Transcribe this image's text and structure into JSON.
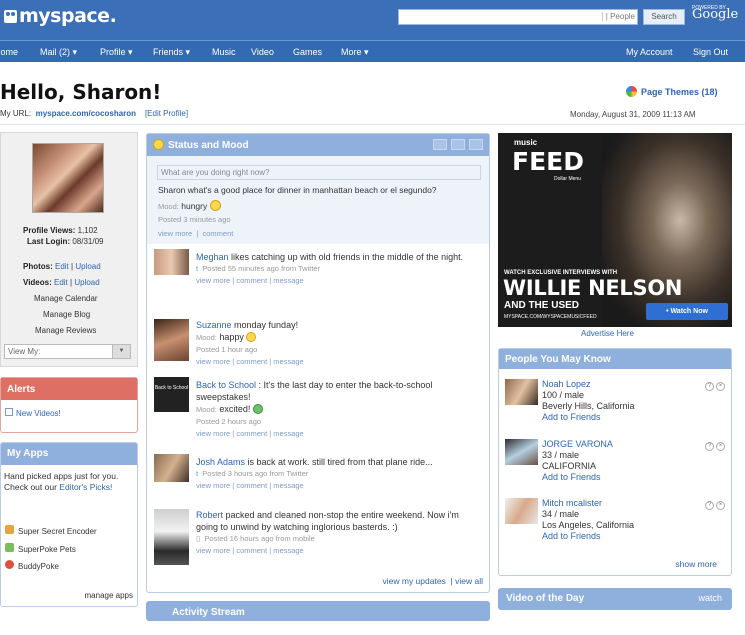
{
  "brand": {
    "logo": "myspace.",
    "powered": "POWERED BY",
    "google": "Google"
  },
  "search": {
    "placeholder": "",
    "scope": "| People",
    "button": "Search"
  },
  "nav": {
    "items": [
      "Home",
      "Mail (2) ▾",
      "Profile ▾",
      "Friends ▾",
      "Music",
      "Video",
      "Games",
      "More ▾"
    ],
    "right": [
      "My Account",
      "Sign Out"
    ]
  },
  "header": {
    "greeting": "Hello, Sharon!",
    "url_label": "My URL:",
    "url": "myspace.com/cocosharon",
    "edit_profile": "[Edit Profile]",
    "page_themes": "Page Themes (18)",
    "date": "Monday, August 31, 2009 11:13 AM"
  },
  "profile": {
    "views_label": "Profile Views:",
    "views": "1,102",
    "login_label": "Last Login:",
    "login": "08/31/09",
    "photos_label": "Photos:",
    "videos_label": "Videos:",
    "edit": "Edit",
    "upload": "Upload",
    "links": [
      "Manage Calendar",
      "Manage Blog",
      "Manage Reviews"
    ],
    "view_my": "View My:"
  },
  "alerts": {
    "title": "Alerts",
    "item": "New Videos!"
  },
  "apps": {
    "title": "My Apps",
    "blurb": "Hand picked apps just for you. Check out our ",
    "editors": "Editor's Picks!",
    "items": [
      "Super Secret Encoder",
      "SuperPoke Pets",
      "BuddyPoke"
    ],
    "manage": "manage apps"
  },
  "status": {
    "title": "Status and Mood",
    "placeholder": "What are you doing right now?",
    "text": "Sharon what's a good place for dinner in manhattan beach or el segundo?",
    "mood_label": "Mood:",
    "mood": "hungry",
    "posted": "Posted 3 minutes ago",
    "view_more": "view more",
    "comment": "comment",
    "message": "message",
    "view_updates": "view my updates",
    "view_all": "| view all"
  },
  "feed": [
    {
      "name": "Meghan",
      "text": " likes catching up with old friends in the middle of the night.",
      "posted": "Posted 55 minutes ago from Twitter",
      "mood": ""
    },
    {
      "name": "Suzanne",
      "text": " monday funday!",
      "mood": "happy",
      "posted": "Posted 1 hour ago"
    },
    {
      "name": "Back to School",
      "text": " : It's the last day to enter the back-to-school sweepstakes!",
      "mood": "excited!",
      "posted": "Posted 2 hours ago"
    },
    {
      "name": "Josh Adams",
      "text": " is back at work. still tired from that plane ride...",
      "posted": "Posted 3 hours ago from Twitter",
      "mood": ""
    },
    {
      "name": "Robert",
      "text": " packed and cleaned non-stop the entire weekend. Now i'm going to unwind by watching inglorious basterds. :)",
      "posted": "Posted 16 hours ago from mobile",
      "mood": ""
    }
  ],
  "ad": {
    "brand": "music",
    "feed": "FEED",
    "sub": "Dollar Menu",
    "exclusive": "WATCH EXCLUSIVE INTERVIEWS WITH",
    "artist": "WILLIE NELSON",
    "and": "AND THE USED",
    "url": "MYSPACE.COM/WYSPACEMUSICFEED",
    "watch": "• Watch Now",
    "advertise": "Advertise Here"
  },
  "pymk": {
    "title": "People You May Know",
    "people": [
      {
        "name": "Noah Lopez",
        "info": "100 / male",
        "loc": "Beverly Hills, California",
        "add": "Add to Friends"
      },
      {
        "name": "JORGE VARONA",
        "info": "33 / male",
        "loc": "CALIFORNIA",
        "add": "Add to Friends"
      },
      {
        "name": "Mitch mcalister",
        "info": "34 / male",
        "loc": "Los Angeles, California",
        "add": "Add to Friends"
      }
    ],
    "show_more": "show more"
  },
  "video": {
    "title": "Video of the Day",
    "watch": "watch"
  },
  "activity": {
    "title": "Activity Stream"
  }
}
